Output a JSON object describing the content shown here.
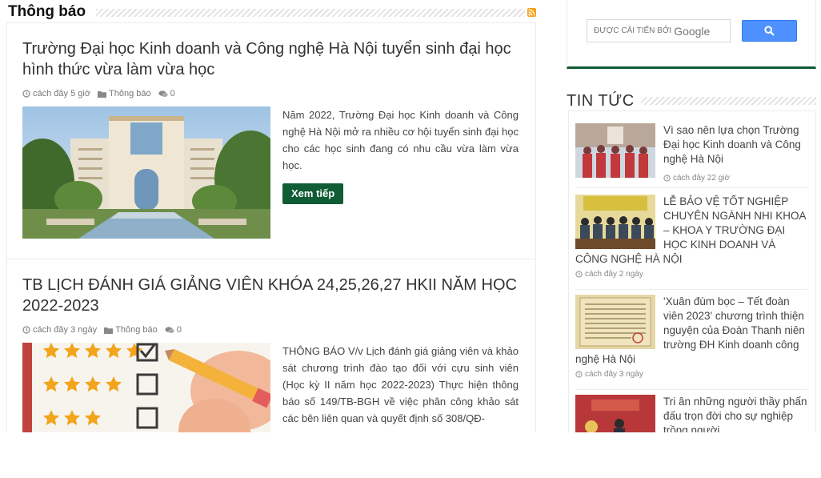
{
  "section": {
    "title": "Thông báo"
  },
  "posts": [
    {
      "title": "Trường Đại học Kinh doanh và Công nghệ Hà Nội tuyển sinh đại học hình thức vừa làm vừa học",
      "time": "cách đây 5 giờ",
      "category": "Thông báo",
      "comments": "0",
      "excerpt": "Năm 2022, Trường Đại học Kinh doanh và Công nghệ Hà Nội mở ra nhiều cơ hội tuyển sinh đại học cho các học sinh đang có nhu cầu vừa làm vừa học.",
      "more": "Xem tiếp"
    },
    {
      "title": "TB LỊCH ĐÁNH GIÁ GIẢNG VIÊN KHÓA 24,25,26,27 HKII NĂM HỌC 2022-2023",
      "time": "cách đây 3 ngày",
      "category": "Thông báo",
      "comments": "0",
      "excerpt": "THÔNG BÁO V/v Lịch đánh giá giảng viên và khảo sát chương trình đào tạo đối với cựu sinh viên (Học kỳ II năm học 2022-2023) Thực hiện thông báo số 149/TB-BGH về việc phân công khảo sát các bên liên quan và quyết định số 308/QĐ-"
    }
  ],
  "search": {
    "powered": "ĐƯỢC CẢI TIẾN BỞI",
    "brand": "Google"
  },
  "sidebar": {
    "title": "TIN TỨC",
    "items": [
      {
        "title": "Vì sao nên lựa chọn Trường Đại học Kinh doanh và Công nghệ Hà Nội",
        "time": "cách đây 22 giờ"
      },
      {
        "title": "LỄ BẢO VỆ TỐT NGHIỆP CHUYÊN NGÀNH NHI KHOA – KHOA Y TRƯỜNG ĐẠI HỌC KINH DOANH VÀ CÔNG NGHỆ HÀ NỘI",
        "time": "cách đây 2 ngày"
      },
      {
        "title": "'Xuân đùm bọc – Tết đoàn viên 2023' chương trình thiện nguyện của Đoàn Thanh niên trường ĐH Kinh doanh công nghệ Hà Nội",
        "time": "cách đây 3 ngày"
      },
      {
        "title": "Tri ân những người thầy phấn đấu trọn đời cho sự nghiệp trồng người"
      }
    ]
  },
  "colors": {
    "accent": "#0f5c35",
    "search_button": "#4d90fe",
    "rss": "#f7a21b"
  }
}
